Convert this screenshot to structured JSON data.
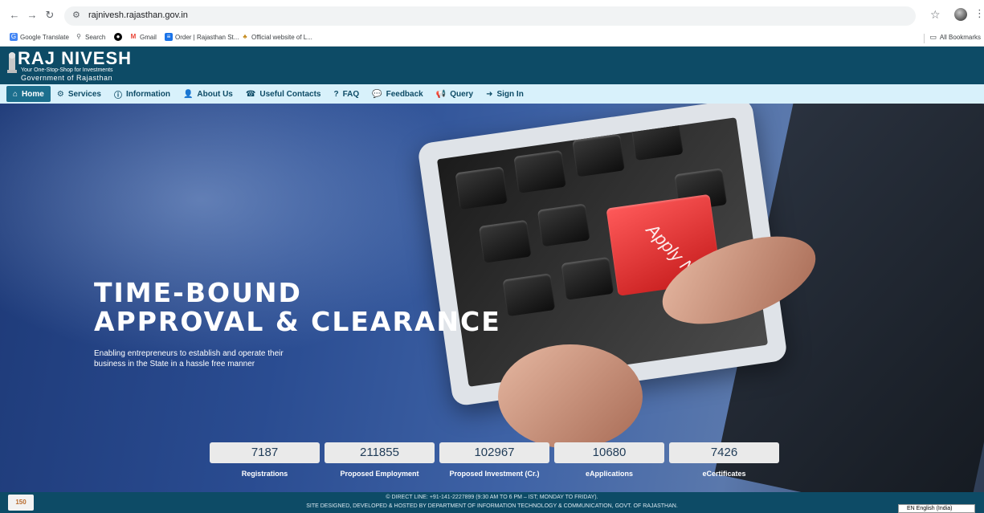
{
  "browser": {
    "url": "rajnivesh.rajasthan.gov.in",
    "bookmarks": [
      {
        "label": "Google Translate",
        "icon": "translate-icon",
        "color": "#4285f4"
      },
      {
        "label": "Search",
        "icon": "search-icon",
        "color": "#5f6368"
      },
      {
        "label": "",
        "icon": "github-icon",
        "color": "#000000"
      },
      {
        "label": "Gmail",
        "icon": "gmail-icon",
        "color": "#ea4335"
      },
      {
        "label": "Order | Rajasthan St...",
        "icon": "order-icon",
        "color": "#1a73e8"
      },
      {
        "label": "Official website of L...",
        "icon": "emblem-icon",
        "color": "#c58b1e"
      }
    ],
    "all_bookmarks": "All Bookmarks"
  },
  "header": {
    "title": "RAJ NIVESH",
    "tagline": "Your One-Stop-Shop for Investments",
    "gov": "Government of Rajasthan",
    "bg_color": "#0d4b66"
  },
  "nav": {
    "items": [
      {
        "label": "Home",
        "icon": "home-icon",
        "glyph": "⌂"
      },
      {
        "label": "Services",
        "icon": "gear-icon",
        "glyph": "⚙"
      },
      {
        "label": "Information",
        "icon": "info-icon",
        "glyph": "ⓘ"
      },
      {
        "label": "About Us",
        "icon": "user-icon",
        "glyph": "👤"
      },
      {
        "label": "Useful Contacts",
        "icon": "contact-icon",
        "glyph": "☎"
      },
      {
        "label": "FAQ",
        "icon": "question-icon",
        "glyph": "?"
      },
      {
        "label": "Feedback",
        "icon": "comments-icon",
        "glyph": "💬"
      },
      {
        "label": "Query",
        "icon": "megaphone-icon",
        "glyph": "📢"
      },
      {
        "label": "Sign In",
        "icon": "sign-in-icon",
        "glyph": "➜"
      }
    ]
  },
  "hero": {
    "title_line1": "TIME-BOUND",
    "title_line2": "APPROVAL & CLEARANCE",
    "subtitle": "Enabling entrepreneurs to establish and operate their business in the State in a hassle free manner",
    "key_label": "Apply Now"
  },
  "stats": [
    {
      "value": "7187",
      "label": "Registrations"
    },
    {
      "value": "211855",
      "label": "Proposed Employment"
    },
    {
      "value": "102967",
      "label": "Proposed Investment (Cr.)"
    },
    {
      "value": "10680",
      "label": "eApplications"
    },
    {
      "value": "7426",
      "label": "eCertificates"
    }
  ],
  "footer": {
    "line1": "© DIRECT LINE: +91-141-2227899 (9:30 AM TO 6 PM – IST; MONDAY TO FRIDAY).",
    "line2": "SITE DESIGNED, DEVELOPED & HOSTED BY DEPARTMENT OF INFORMATION TECHNOLOGY & COMMUNICATION, GOVT. OF RAJASTHAN.",
    "language": "EN English (India)"
  }
}
